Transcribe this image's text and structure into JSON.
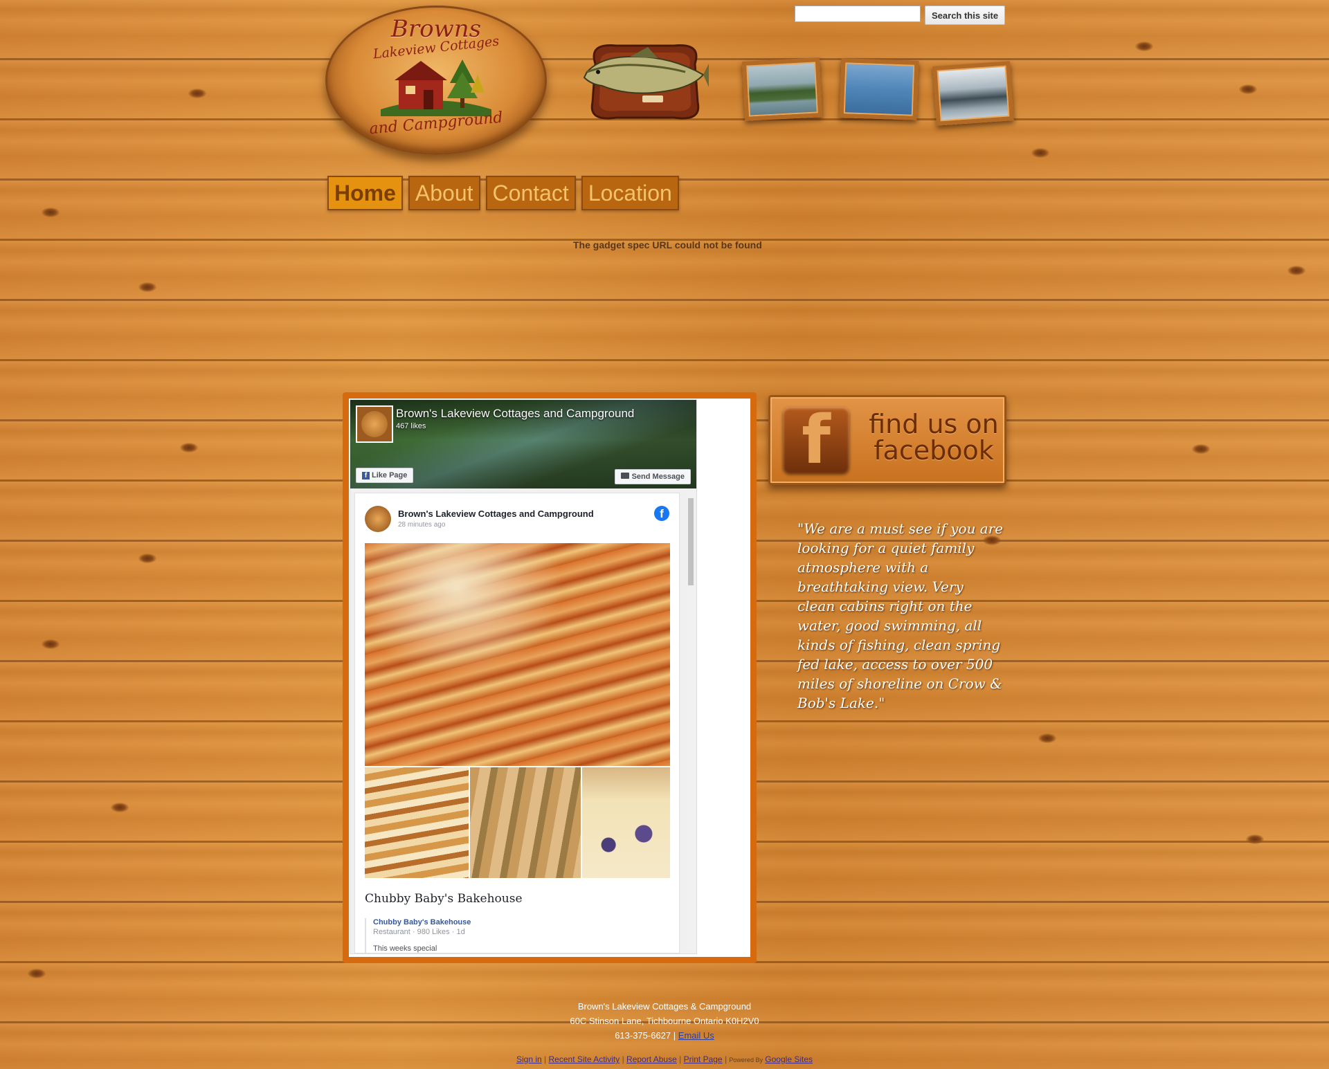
{
  "search": {
    "placeholder": "",
    "button_label": "Search this site"
  },
  "logo": {
    "line1": "Browns",
    "line2": "Lakeview Cottages",
    "line3": "and Campground"
  },
  "nav": {
    "items": [
      {
        "label": "Home"
      },
      {
        "label": "About"
      },
      {
        "label": "Contact"
      },
      {
        "label": "Location"
      }
    ]
  },
  "gadget_error": "The gadget spec URL could not be found",
  "fb_widget": {
    "page_name": "Brown's Lakeview Cottages and Campground",
    "likes": "467 likes",
    "like_button": "Like Page",
    "send_button": "Send Message",
    "post": {
      "author": "Brown's Lakeview Cottages and Campground",
      "time": "28 minutes ago",
      "shared_title": "Chubby Baby's Bakehouse",
      "shared_name": "Chubby Baby's Bakehouse",
      "shared_meta": "Restaurant · 980 Likes · 1d",
      "shared_text": "This weeks special"
    }
  },
  "fb_badge": {
    "text": "find us on facebook",
    "icon": "f"
  },
  "testimonial": "\"We are a must see if you are looking for a quiet family atmosphere with a breathtaking view. Very clean cabins right on the water, good swimming, all kinds of fishing, clean spring fed lake, access to over 500 miles of shoreline on Crow & Bob's Lake.\"",
  "footer": {
    "line1": "Brown's Lakeview Cottages & Campground",
    "line2": "60C Stinson Lane, Tichbourne Ontario K0H2V0",
    "phone": "613-375-6627",
    "separator": "|",
    "email_link": "Email Us"
  },
  "site_links": {
    "sign_in": "Sign in",
    "recent_activity": "Recent Site Activity",
    "report_abuse": "Report Abuse",
    "print_page": "Print Page",
    "powered_by": "Powered By",
    "google_sites": "Google Sites",
    "sep": "|"
  },
  "colors": {
    "wood": "#d9893a",
    "panel_border": "#d66a0f",
    "nav_active": "#e4920f",
    "fb_blue": "#1877f2"
  }
}
